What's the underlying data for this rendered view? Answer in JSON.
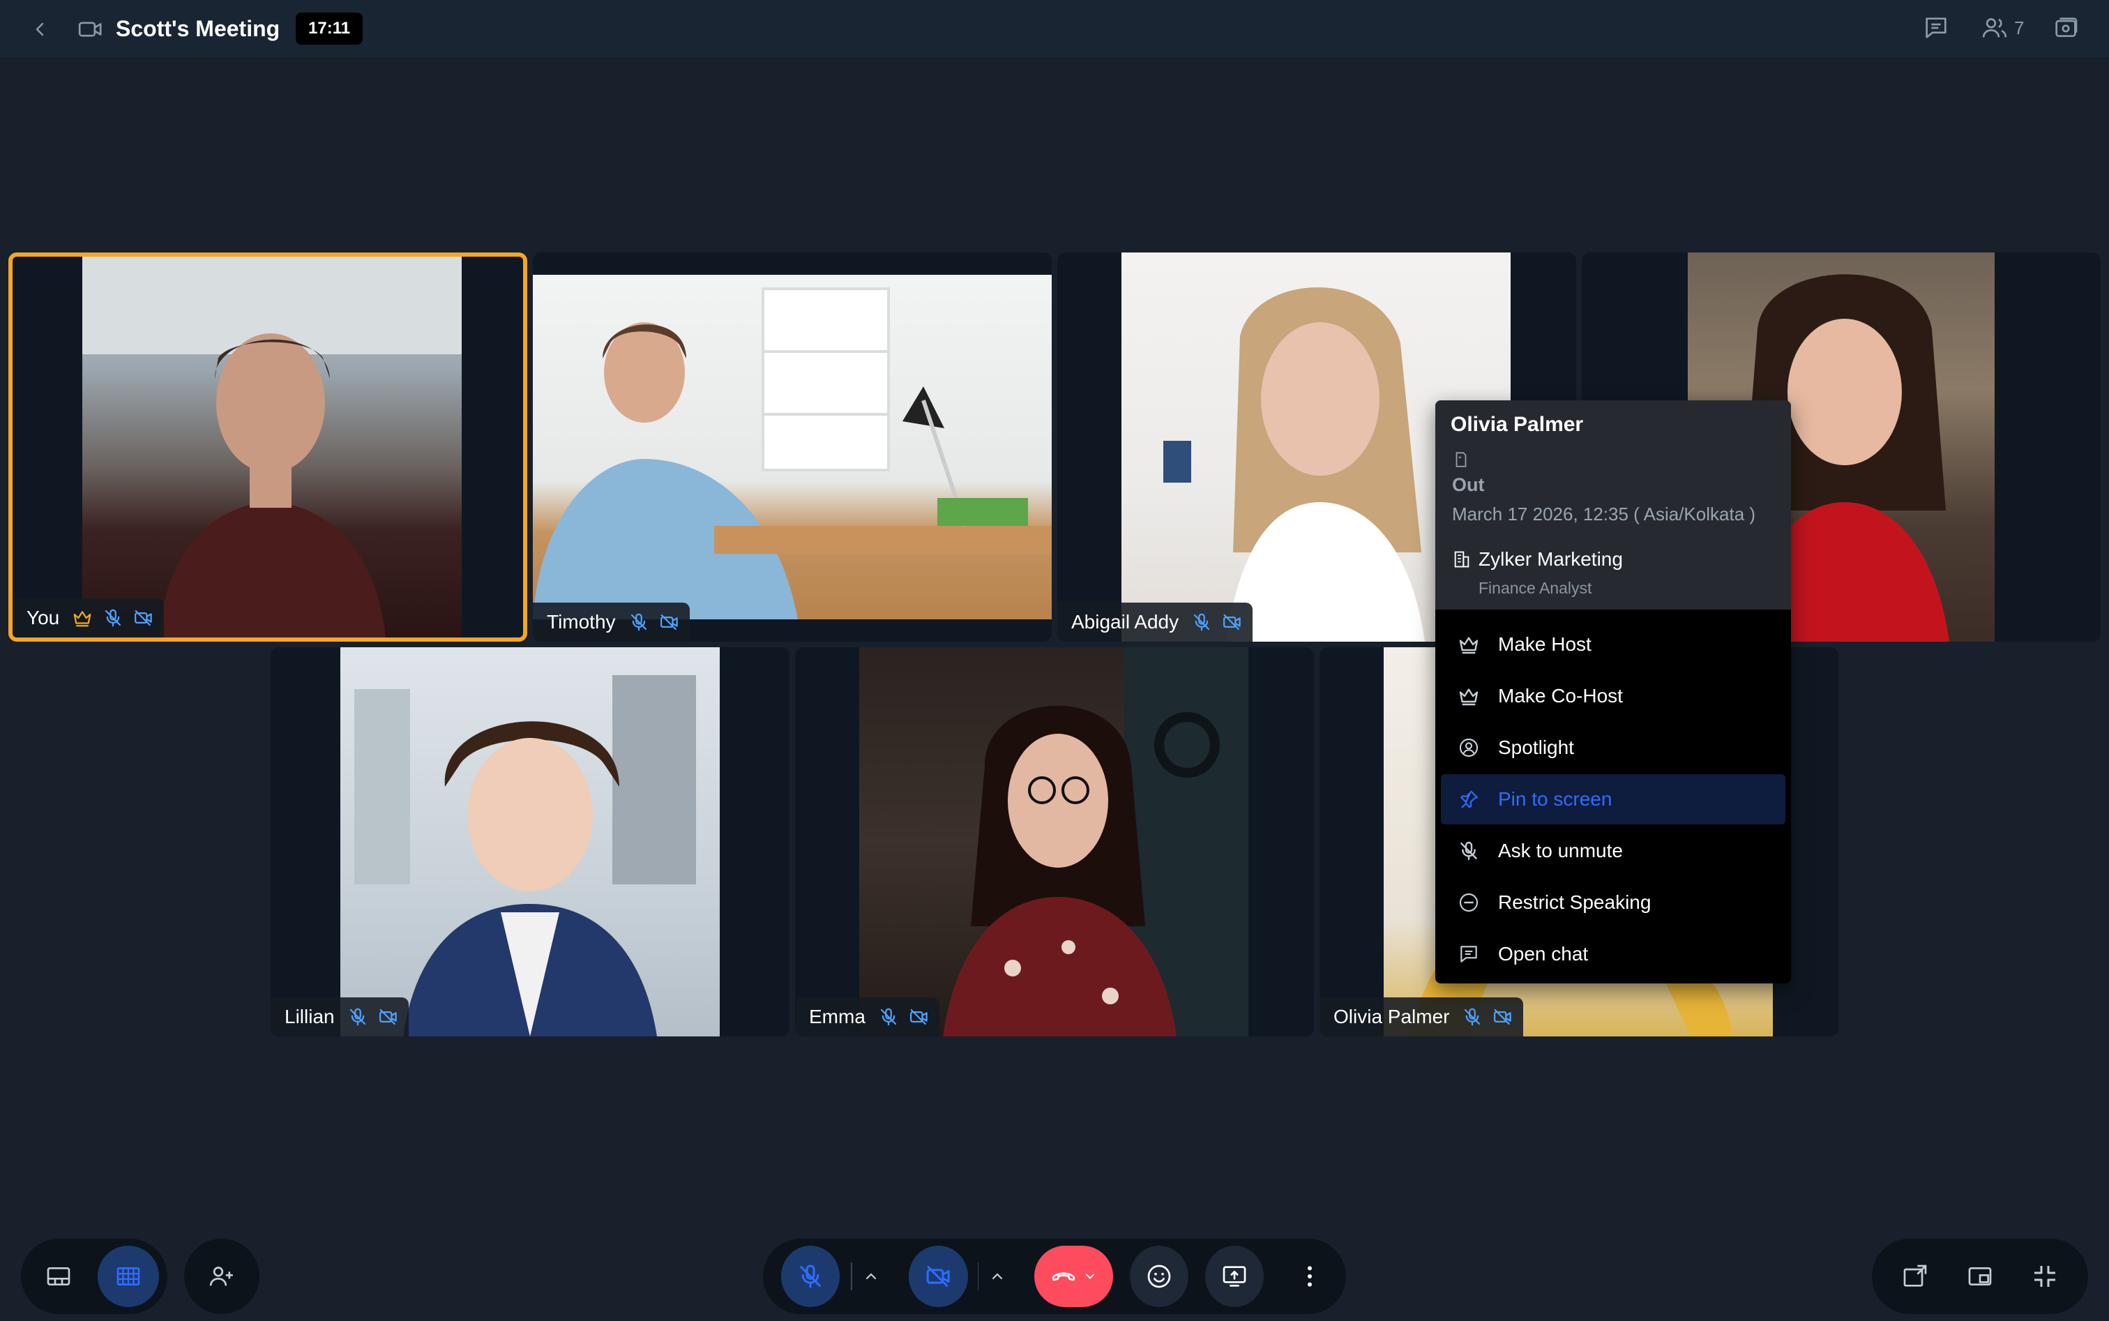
{
  "header": {
    "title": "Scott's Meeting",
    "timer": "17:11",
    "participants_count": "7"
  },
  "tiles": [
    {
      "name": "You",
      "host": true
    },
    {
      "name": "Timothy"
    },
    {
      "name": "Abigail Addy"
    },
    {
      "name": ""
    },
    {
      "name": "Lillian"
    },
    {
      "name": "Emma"
    },
    {
      "name": "Olivia Palmer"
    }
  ],
  "popup": {
    "name": "Olivia Palmer",
    "status": "Out",
    "datetime": "March 17 2026, 12:35 ( Asia/Kolkata )",
    "org": "Zylker Marketing",
    "role": "Finance Analyst",
    "menu": [
      {
        "label": "Make Host",
        "icon": "crown-icon"
      },
      {
        "label": "Make Co-Host",
        "icon": "crown-icon"
      },
      {
        "label": "Spotlight",
        "icon": "spotlight-icon"
      },
      {
        "label": "Pin to screen",
        "icon": "pin-icon",
        "selected": true
      },
      {
        "label": "Ask to unmute",
        "icon": "mic-off-icon"
      },
      {
        "label": "Restrict Speaking",
        "icon": "minus-circle-icon"
      },
      {
        "label": "Open chat",
        "icon": "chat-icon"
      }
    ]
  },
  "colors": {
    "background": "#17202b",
    "active_border": "#f5a623",
    "accent_blue": "#2f6dff",
    "leave_red": "#ff4b5e",
    "icon_blue": "#4da3ff"
  }
}
